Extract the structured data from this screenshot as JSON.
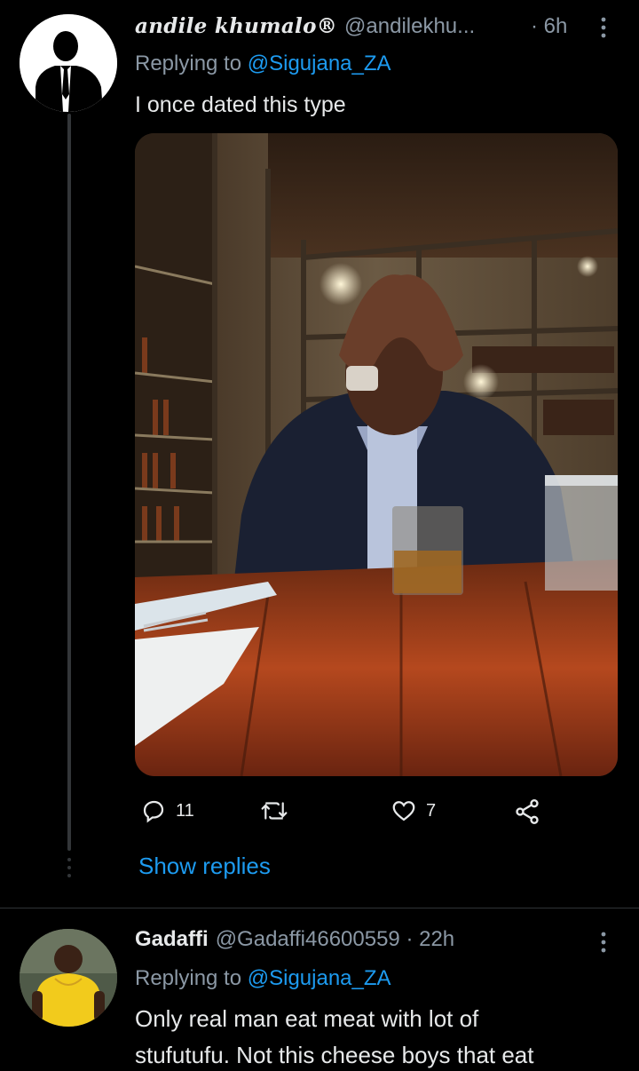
{
  "tweet1": {
    "display_name": "andile khumalo®",
    "handle": "@andilekhu...",
    "time": "· 6h",
    "replying_to_prefix": "Replying to ",
    "replying_to_handle": "@Sigujana_ZA",
    "text": "I once dated this type",
    "replies": "11",
    "retweets": "",
    "likes": "7",
    "show_replies": "Show replies"
  },
  "tweet2": {
    "display_name": "Gadaffi",
    "handle": "@Gadaffi46600559 · 22h",
    "replying_to_prefix": "Replying to ",
    "replying_to_handle": "@Sigujana_ZA",
    "text_line1": "Only real man eat meat with lot of",
    "text_line2": "stufutufu. Not this cheese boys that eat"
  },
  "colors": {
    "background": "#000000",
    "link": "#1d9bf0",
    "secondary_text": "#8b98a5",
    "primary_text": "#e7e9ea"
  }
}
